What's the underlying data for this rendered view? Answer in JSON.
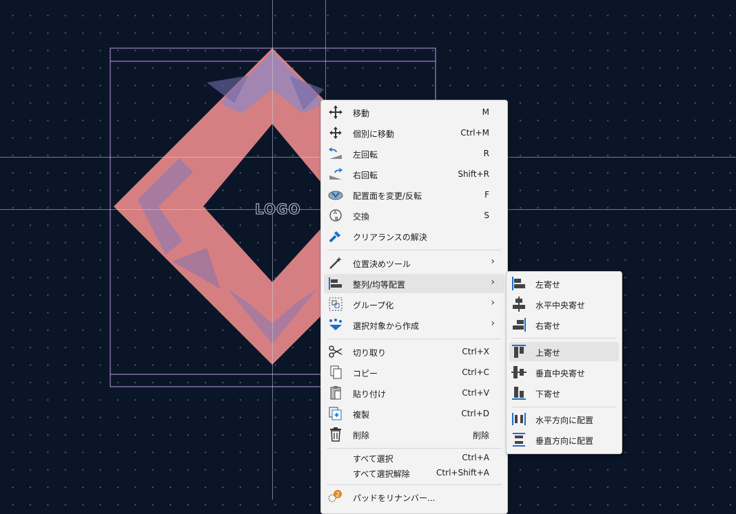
{
  "canvas": {
    "logo_text": "LOGO"
  },
  "context_menu": {
    "items": [
      {
        "label": "移動",
        "shortcut": "M",
        "icon": "move-icon"
      },
      {
        "label": "個別に移動",
        "shortcut": "Ctrl+M",
        "icon": "move-individually-icon"
      },
      {
        "label": "左回転",
        "shortcut": "R",
        "icon": "rotate-ccw-icon"
      },
      {
        "label": "右回転",
        "shortcut": "Shift+R",
        "icon": "rotate-cw-icon"
      },
      {
        "label": "配置面を変更/反転",
        "shortcut": "F",
        "icon": "flip-icon"
      },
      {
        "label": "交換",
        "shortcut": "S",
        "icon": "swap-icon"
      },
      {
        "label": "クリアランスの解決",
        "shortcut": "",
        "icon": "clearance-icon"
      },
      {
        "label": "位置決めツール",
        "shortcut": "",
        "icon": "positioning-tool-icon",
        "submenu": true
      },
      {
        "label": "整列/均等配置",
        "shortcut": "",
        "icon": "align-icon",
        "submenu": true,
        "highlighted": true
      },
      {
        "label": "グループ化",
        "shortcut": "",
        "icon": "group-icon",
        "submenu": true
      },
      {
        "label": "選択対象から作成",
        "shortcut": "",
        "icon": "create-from-selection-icon",
        "submenu": true
      },
      {
        "label": "切り取り",
        "shortcut": "Ctrl+X",
        "icon": "cut-icon"
      },
      {
        "label": "コピー",
        "shortcut": "Ctrl+C",
        "icon": "copy-icon"
      },
      {
        "label": "貼り付け",
        "shortcut": "Ctrl+V",
        "icon": "paste-icon"
      },
      {
        "label": "複製",
        "shortcut": "Ctrl+D",
        "icon": "duplicate-icon"
      },
      {
        "label": "削除",
        "shortcut": "削除",
        "icon": "delete-icon"
      },
      {
        "label": "すべて選択",
        "shortcut": "Ctrl+A",
        "icon": ""
      },
      {
        "label": "すべて選択解除",
        "shortcut": "Ctrl+Shift+A",
        "icon": ""
      },
      {
        "label": "パッドをリナンバー...",
        "shortcut": "",
        "icon": "renumber-pads-icon",
        "badge": "2"
      }
    ]
  },
  "align_submenu": {
    "items": [
      {
        "label": "左寄せ",
        "icon": "align-left-icon"
      },
      {
        "label": "水平中央寄せ",
        "icon": "align-center-horizontal-icon"
      },
      {
        "label": "右寄せ",
        "icon": "align-right-icon"
      },
      {
        "label": "上寄せ",
        "icon": "align-top-icon",
        "highlighted": true
      },
      {
        "label": "垂直中央寄せ",
        "icon": "align-center-vertical-icon"
      },
      {
        "label": "下寄せ",
        "icon": "align-bottom-icon"
      },
      {
        "label": "水平方向に配置",
        "icon": "distribute-horizontal-icon"
      },
      {
        "label": "垂直方向に配置",
        "icon": "distribute-vertical-icon"
      }
    ]
  },
  "colors": {
    "canvas_bg": "#0a1628",
    "silkscreen": "#e8898a",
    "courtyard": "#b89ad8",
    "accent_blue": "#1e6ec8"
  }
}
